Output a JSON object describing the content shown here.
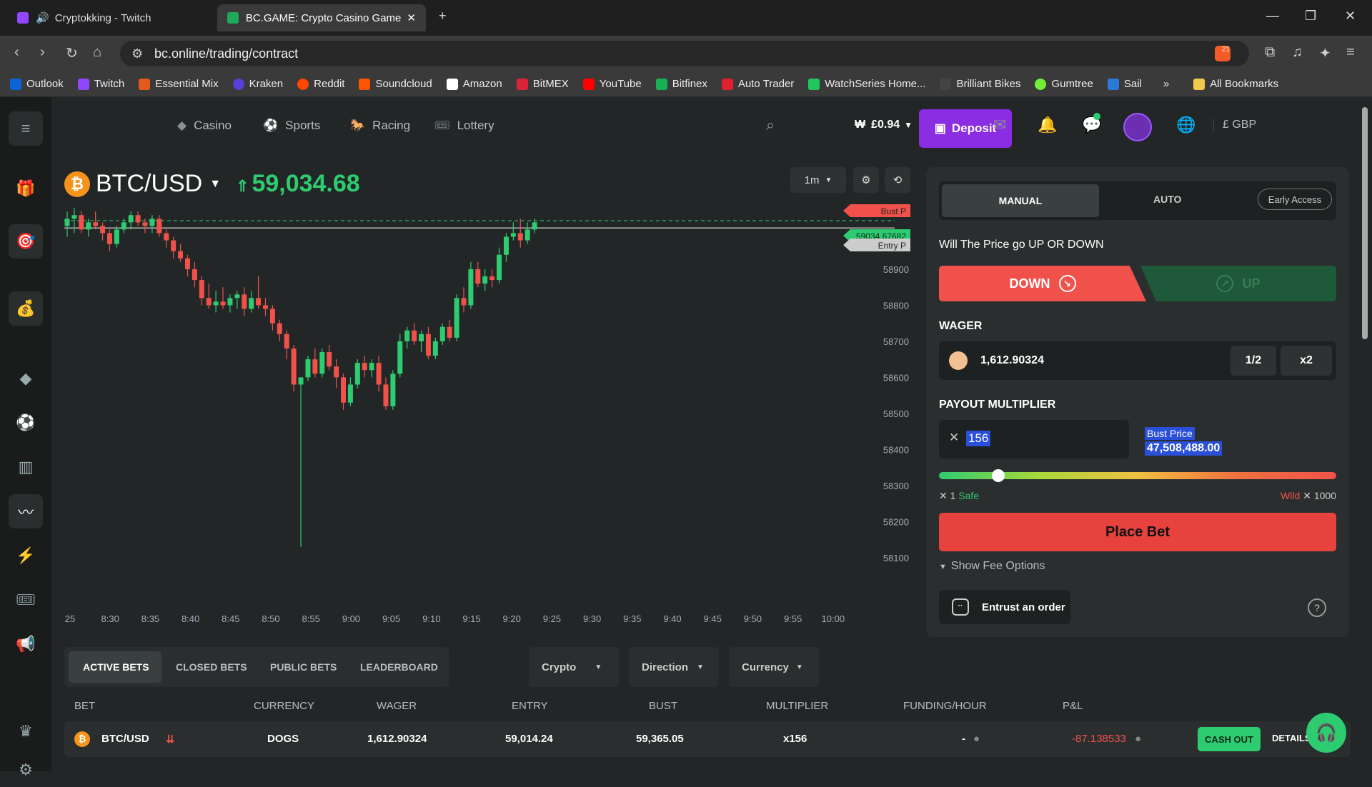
{
  "browser": {
    "tabs": [
      {
        "title": "Cryptokking - Twitch"
      },
      {
        "title": "BC.GAME: Crypto Casino Game"
      }
    ],
    "url": "bc.online/trading/contract",
    "bookmarks": [
      "Outlook",
      "Twitch",
      "Essential Mix",
      "Kraken",
      "Reddit",
      "Soundcloud",
      "Amazon",
      "BitMEX",
      "YouTube",
      "Bitfinex",
      "Auto Trader",
      "WatchSeries Home...",
      "Brilliant Bikes",
      "Gumtree",
      "Sail"
    ],
    "all_bookmarks": "All Bookmarks",
    "brave_badge": "21"
  },
  "nav": {
    "items": [
      "Casino",
      "Sports",
      "Racing",
      "Lottery"
    ],
    "balance": "£0.94",
    "deposit": "Deposit",
    "currency": "£ GBP"
  },
  "chart": {
    "pair": "BTC/USD",
    "price": "59,034.68",
    "interval": "1m",
    "bust_label": "Bust P",
    "entry_label": "Entry P",
    "live_price": "59034.67682",
    "yticks": [
      "58900",
      "58800",
      "58700",
      "58600",
      "58500",
      "58400",
      "58300",
      "58200",
      "58100"
    ],
    "xticks": [
      "25",
      "8:30",
      "8:35",
      "8:40",
      "8:45",
      "8:50",
      "8:55",
      "9:00",
      "9:05",
      "9:10",
      "9:15",
      "9:20",
      "9:25",
      "9:30",
      "9:35",
      "9:40",
      "9:45",
      "9:50",
      "9:55",
      "10:00"
    ]
  },
  "chart_data": {
    "type": "candlestick",
    "title": "BTC/USD",
    "ylim": [
      58050,
      59100
    ],
    "current_price": 59034.68,
    "entry_price": 59014.24,
    "candles": [
      [
        59020,
        59060,
        58990,
        59040
      ],
      [
        59040,
        59070,
        59000,
        59050
      ],
      [
        59050,
        59060,
        59000,
        59010
      ],
      [
        59010,
        59040,
        58990,
        59030
      ],
      [
        59030,
        59060,
        59010,
        59020
      ],
      [
        59020,
        59030,
        58980,
        59000
      ],
      [
        59000,
        59010,
        58950,
        58970
      ],
      [
        58970,
        59020,
        58960,
        59010
      ],
      [
        59010,
        59040,
        59000,
        59030
      ],
      [
        59030,
        59060,
        59010,
        59050
      ],
      [
        59050,
        59060,
        59020,
        59030
      ],
      [
        59030,
        59040,
        59000,
        59020
      ],
      [
        59020,
        59050,
        59000,
        59040
      ],
      [
        59040,
        59050,
        58990,
        59000
      ],
      [
        59000,
        59010,
        58960,
        58980
      ],
      [
        58980,
        58990,
        58930,
        58950
      ],
      [
        58950,
        58970,
        58920,
        58930
      ],
      [
        58930,
        58940,
        58880,
        58900
      ],
      [
        58900,
        58920,
        58850,
        58870
      ],
      [
        58870,
        58880,
        58800,
        58820
      ],
      [
        58820,
        58860,
        58790,
        58800
      ],
      [
        58800,
        58840,
        58780,
        58810
      ],
      [
        58810,
        58850,
        58790,
        58800
      ],
      [
        58800,
        58830,
        58780,
        58820
      ],
      [
        58820,
        58840,
        58790,
        58830
      ],
      [
        58830,
        58850,
        58770,
        58790
      ],
      [
        58790,
        58840,
        58780,
        58820
      ],
      [
        58820,
        58880,
        58790,
        58800
      ],
      [
        58800,
        58820,
        58770,
        58790
      ],
      [
        58790,
        58800,
        58730,
        58750
      ],
      [
        58750,
        58760,
        58700,
        58720
      ],
      [
        58720,
        58730,
        58650,
        58680
      ],
      [
        58680,
        58690,
        58560,
        58580
      ],
      [
        58580,
        58600,
        58130,
        58600
      ],
      [
        58600,
        58660,
        58590,
        58650
      ],
      [
        58650,
        58680,
        58600,
        58610
      ],
      [
        58610,
        58680,
        58600,
        58670
      ],
      [
        58670,
        58690,
        58620,
        58630
      ],
      [
        58630,
        58650,
        58570,
        58600
      ],
      [
        58600,
        58610,
        58510,
        58530
      ],
      [
        58530,
        58600,
        58520,
        58580
      ],
      [
        58580,
        58650,
        58570,
        58640
      ],
      [
        58640,
        58660,
        58600,
        58620
      ],
      [
        58620,
        58650,
        58600,
        58640
      ],
      [
        58640,
        58660,
        58560,
        58580
      ],
      [
        58580,
        58600,
        58510,
        58520
      ],
      [
        58520,
        58620,
        58510,
        58610
      ],
      [
        58610,
        58720,
        58600,
        58700
      ],
      [
        58700,
        58740,
        58680,
        58730
      ],
      [
        58730,
        58750,
        58690,
        58700
      ],
      [
        58700,
        58730,
        58670,
        58720
      ],
      [
        58720,
        58740,
        58650,
        58660
      ],
      [
        58660,
        58710,
        58650,
        58700
      ],
      [
        58700,
        58750,
        58690,
        58740
      ],
      [
        58740,
        58760,
        58700,
        58710
      ],
      [
        58710,
        58830,
        58700,
        58820
      ],
      [
        58820,
        58850,
        58780,
        58800
      ],
      [
        58800,
        58920,
        58790,
        58900
      ],
      [
        58900,
        58920,
        58850,
        58860
      ],
      [
        58860,
        58900,
        58840,
        58880
      ],
      [
        58880,
        58900,
        58850,
        58870
      ],
      [
        58870,
        58960,
        58860,
        58940
      ],
      [
        58940,
        59000,
        58920,
        58990
      ],
      [
        58990,
        59030,
        58980,
        59000
      ],
      [
        59000,
        59040,
        58960,
        58980
      ],
      [
        58980,
        59030,
        58970,
        59010
      ],
      [
        59010,
        59040,
        59000,
        59030
      ]
    ]
  },
  "panel": {
    "mode_manual": "MANUAL",
    "mode_auto": "AUTO",
    "early_access": "Early Access",
    "question": "Will The Price go UP OR DOWN",
    "down": "DOWN",
    "up": "UP",
    "wager_label": "WAGER",
    "wager_value": "1,612.90324",
    "half": "1/2",
    "double": "x2",
    "multiplier_label": "PAYOUT MULTIPLIER",
    "multiplier_value": "156",
    "bust_price_label": "Bust Price",
    "bust_price_value": "47,508,488.00",
    "slider_min": "1",
    "slider_min_label": "Safe",
    "slider_max_label": "Wild",
    "slider_max": "1000",
    "slider_fraction": 0.15,
    "place_bet": "Place Bet",
    "fee_options": "Show Fee Options",
    "entrust": "Entrust an order"
  },
  "bets": {
    "tabs": [
      "ACTIVE BETS",
      "CLOSED BETS",
      "PUBLIC BETS",
      "LEADERBOARD"
    ],
    "filters": [
      "Crypto",
      "Direction",
      "Currency"
    ],
    "columns": [
      "BET",
      "CURRENCY",
      "WAGER",
      "ENTRY",
      "BUST",
      "MULTIPLIER",
      "FUNDING/HOUR",
      "P&L"
    ],
    "row": {
      "bet": "BTC/USD",
      "currency": "DOGS",
      "wager": "1,612.90324",
      "entry": "59,014.24",
      "bust": "59,365.05",
      "multiplier": "x156",
      "funding": "-",
      "pnl": "-87.138533",
      "cashout": "CASH OUT",
      "details": "DETAILS"
    }
  },
  "colors": {
    "up": "#2ecc71",
    "down": "#f0524b",
    "accent": "#8b2de3"
  }
}
